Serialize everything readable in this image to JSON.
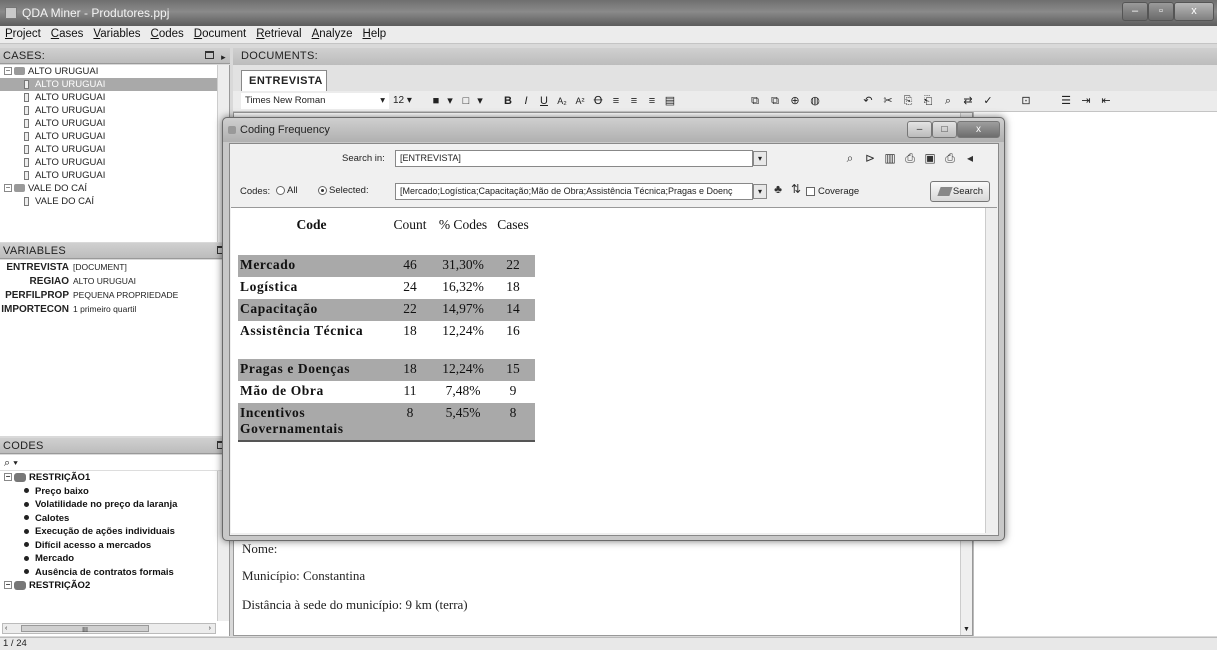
{
  "window": {
    "title": "QDA Miner - Produtores.ppj",
    "min": "–",
    "max": "▫",
    "close": "x"
  },
  "menu": [
    "Project",
    "Cases",
    "Variables",
    "Codes",
    "Document",
    "Retrieval",
    "Analyze",
    "Help"
  ],
  "cases_panel": {
    "header": "CASES:",
    "groups": [
      {
        "label": "ALTO URUGUAI",
        "items": [
          "ALTO URUGUAI",
          "ALTO URUGUAI",
          "ALTO URUGUAI",
          "ALTO URUGUAI",
          "ALTO URUGUAI",
          "ALTO URUGUAI",
          "ALTO URUGUAI",
          "ALTO URUGUAI"
        ],
        "selected_index": 0
      },
      {
        "label": "VALE DO CAÍ",
        "items": [
          "VALE DO CAÍ"
        ]
      }
    ]
  },
  "variables_panel": {
    "header": "VARIABLES",
    "rows": [
      {
        "name": "ENTREVISTA",
        "value": "[DOCUMENT]"
      },
      {
        "name": "REGIAO",
        "value": "ALTO URUGUAI"
      },
      {
        "name": "PERFILPROP",
        "value": "PEQUENA PROPRIEDADE"
      },
      {
        "name": "IMPORTECON",
        "value": "1 primeiro quartil"
      }
    ]
  },
  "codes_panel": {
    "header": "CODES",
    "search_glyph": "⌕ ▾",
    "categories": [
      {
        "label": "RESTRIÇÃO1",
        "items": [
          "Preço baixo",
          "Volatilidade no preço da laranja",
          "Calotes",
          "Execução de ações individuais",
          "Difícil acesso a mercados",
          "Mercado",
          "Ausência de contratos formais"
        ]
      },
      {
        "label": "RESTRIÇÃO2",
        "items": []
      }
    ],
    "hscroll_glyph": "III"
  },
  "status": {
    "text": "1 / 24"
  },
  "documents": {
    "header": "DOCUMENTS:",
    "tab": "ENTREVISTA",
    "font": "Times New Roman",
    "size": "12",
    "lines": [
      "Nome:",
      "Município: Constantina",
      "Distância à sede do município: 9 km (terra)"
    ]
  },
  "dialog": {
    "title": "Coding Frequency",
    "search_in_label": "Search in:",
    "search_in_value": "[ENTREVISTA]",
    "codes_label": "Codes:",
    "radio_all": "All",
    "radio_selected": "Selected:",
    "codes_value": "[Mercado;Logística;Capacitação;Mão de Obra;Assistência Técnica;Pragas e Doenç",
    "coverage_label": "Coverage",
    "search_button": "Search",
    "table": {
      "headers": {
        "code": "Code",
        "count": "Count",
        "pct": "% Codes",
        "cases": "Cases"
      },
      "rows": [
        {
          "code": "Mercado",
          "count": "46",
          "pct": "31,30%",
          "cases": "22"
        },
        {
          "code": "Logística",
          "count": "24",
          "pct": "16,32%",
          "cases": "18"
        },
        {
          "code": "Capacitação",
          "count": "22",
          "pct": "14,97%",
          "cases": "14"
        },
        {
          "code": "Assistência Técnica",
          "count": "18",
          "pct": "12,24%",
          "cases": "16"
        },
        {
          "code": "Pragas e Doenças",
          "count": "18",
          "pct": "12,24%",
          "cases": "15"
        },
        {
          "code": "Mão de Obra",
          "count": "11",
          "pct": "7,48%",
          "cases": "9"
        },
        {
          "code": "Incentivos Governamentais",
          "count": "8",
          "pct": "5,45%",
          "cases": "8"
        }
      ]
    }
  }
}
